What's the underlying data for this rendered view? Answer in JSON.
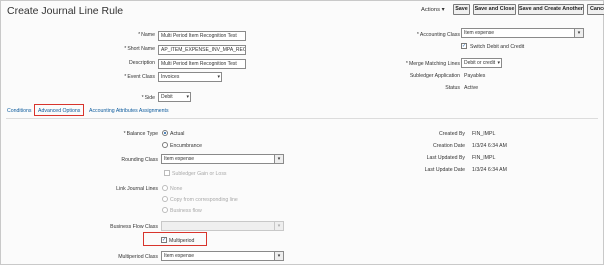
{
  "title": "Create Journal Line Rule",
  "toolbar": {
    "actions": "Actions ▾",
    "save": "Save",
    "save_close": "Save and Close",
    "save_create_another": "Save and Create Another",
    "cancel": "Cancel"
  },
  "header": {
    "name_label": "Name",
    "name_value": "Multi Period Item Recognition Test",
    "short_name_label": "Short Name",
    "short_name_value": "AP_ITEM_EXPENSE_INV_MPA_REC...",
    "description_label": "Description",
    "description_value": "Multi Period Item Recognition Test",
    "event_class_label": "Event Class",
    "event_class_value": "Invoices",
    "side_label": "Side",
    "side_value": "Debit",
    "accounting_class_label": "Accounting Class",
    "accounting_class_value": "Item expense",
    "switch_label": "Switch Debit and Credit",
    "merge_label": "Merge Matching Lines",
    "merge_value": "Debit or credit",
    "subledger_label": "Subledger Application",
    "subledger_value": "Payables",
    "status_label": "Status",
    "status_value": "Active"
  },
  "tabs": [
    "Conditions",
    "Advanced Options",
    "Accounting Attributes Assignments"
  ],
  "advanced": {
    "balance_type_label": "Balance Type",
    "actual": "Actual",
    "encumbrance": "Encumbrance",
    "rounding_class_label": "Rounding Class",
    "rounding_class_value": "Item expense",
    "subledger_gain_loss": "Subledger Gain or Loss",
    "link_label": "Link Journal Lines",
    "link_none": "None",
    "link_copy": "Copy from corresponding line",
    "link_business": "Business flow",
    "business_flow_label": "Business Flow Class",
    "multiperiod": "Multiperiod",
    "multiperiod_class_label": "Multiperiod Class",
    "multiperiod_class_value": "Item expense",
    "created_by_label": "Created By",
    "created_by_value": "FIN_IMPL",
    "creation_date_label": "Creation Date",
    "creation_date_value": "1/3/24 6:34 AM",
    "last_updated_by_label": "Last Updated By",
    "last_updated_by_value": "FIN_IMPL",
    "last_update_date_label": "Last Update Date",
    "last_update_date_value": "1/3/24 6:34 AM"
  },
  "colors": {
    "highlight": "#d8342c",
    "link": "#0b5a9c"
  }
}
